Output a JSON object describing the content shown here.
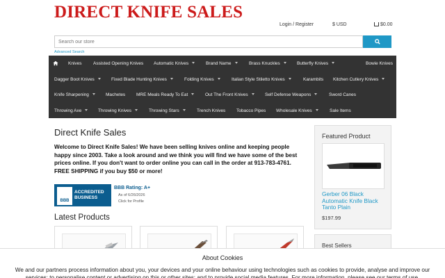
{
  "brand": {
    "logo_text": "DIRECT KNIFE SALES"
  },
  "header": {
    "login_label": "Login / Register",
    "currency_label": "$ USD",
    "cart_label": "$0.00"
  },
  "search": {
    "placeholder": "Search our store",
    "advanced_label": "Advanced Search"
  },
  "nav": {
    "items": [
      {
        "label": "Knives",
        "dropdown": false
      },
      {
        "label": "Assisted Opening Knives",
        "dropdown": false
      },
      {
        "label": "Automatic Knives",
        "dropdown": true
      },
      {
        "label": "Brand Name",
        "dropdown": true
      },
      {
        "label": "Brass Knuckles",
        "dropdown": true
      },
      {
        "label": "Butterfly Knives",
        "dropdown": true
      },
      {
        "label": "Bowie Knives",
        "dropdown": false
      },
      {
        "label": "Dagger Boot Knives",
        "dropdown": true
      },
      {
        "label": "Fixed Blade Hunting Knives",
        "dropdown": true
      },
      {
        "label": "Folding Knives",
        "dropdown": true
      },
      {
        "label": "Italian Style Stiletto Knives",
        "dropdown": true
      },
      {
        "label": "Karambits",
        "dropdown": false
      },
      {
        "label": "Kitchen Cutlery Knives",
        "dropdown": true
      },
      {
        "label": "Knife Sharpening",
        "dropdown": true
      },
      {
        "label": "Machetes",
        "dropdown": false
      },
      {
        "label": "MRE Meals Ready To Eat",
        "dropdown": true
      },
      {
        "label": "Out The Front Knives",
        "dropdown": true
      },
      {
        "label": "Self Defense Weapons",
        "dropdown": true
      },
      {
        "label": "Sword Canes",
        "dropdown": false
      },
      {
        "label": "Throwing Axe",
        "dropdown": true
      },
      {
        "label": "Throwing Knives",
        "dropdown": true
      },
      {
        "label": "Throwing Stars",
        "dropdown": true
      },
      {
        "label": "Trench Knives",
        "dropdown": false
      },
      {
        "label": "Tobacco Pipes",
        "dropdown": false
      },
      {
        "label": "Wholesale Knives",
        "dropdown": true
      },
      {
        "label": "Sale Items",
        "dropdown": false
      }
    ]
  },
  "main": {
    "title": "Direct Knife Sales",
    "welcome_text": "Welcome to Direct Knife Sales! We have been selling knives online and keeping people happy since 2003. Take a look around and we think you will find we have some of the best prices online.  If you don't want to order online you can call in the order at 913-783-4761. FREE SHIPPING if you buy $50 or more!",
    "latest_title": "Latest Products"
  },
  "bbb": {
    "logo_text": "BBB",
    "accredited_line1": "ACCREDITED",
    "accredited_line2": "BUSINESS",
    "rating_text": "BBB Rating: A+",
    "as_of_text": "As of 6/26/2026",
    "click_text": "Click for Profile"
  },
  "sidebar": {
    "featured_title": "Featured Product",
    "featured_name": "Gerber 06 Black Automatic Knife Black Tanto Plain",
    "featured_price": "$197.99",
    "best_sellers_title": "Best Sellers"
  },
  "cookie": {
    "title": "About Cookies",
    "text": "We and our partners process information about you, your devices and your online behaviour using technologies such as cookies to provide, analyse and improve our services; to personalise content or advertising on this or other sites; and to provide social media features. For more information, please see our terms of use."
  },
  "colors": {
    "brand_red": "#cc1b1b",
    "nav_bg": "#333333",
    "accent_blue": "#1f98c6",
    "bbb_blue": "#0b5d8f"
  }
}
